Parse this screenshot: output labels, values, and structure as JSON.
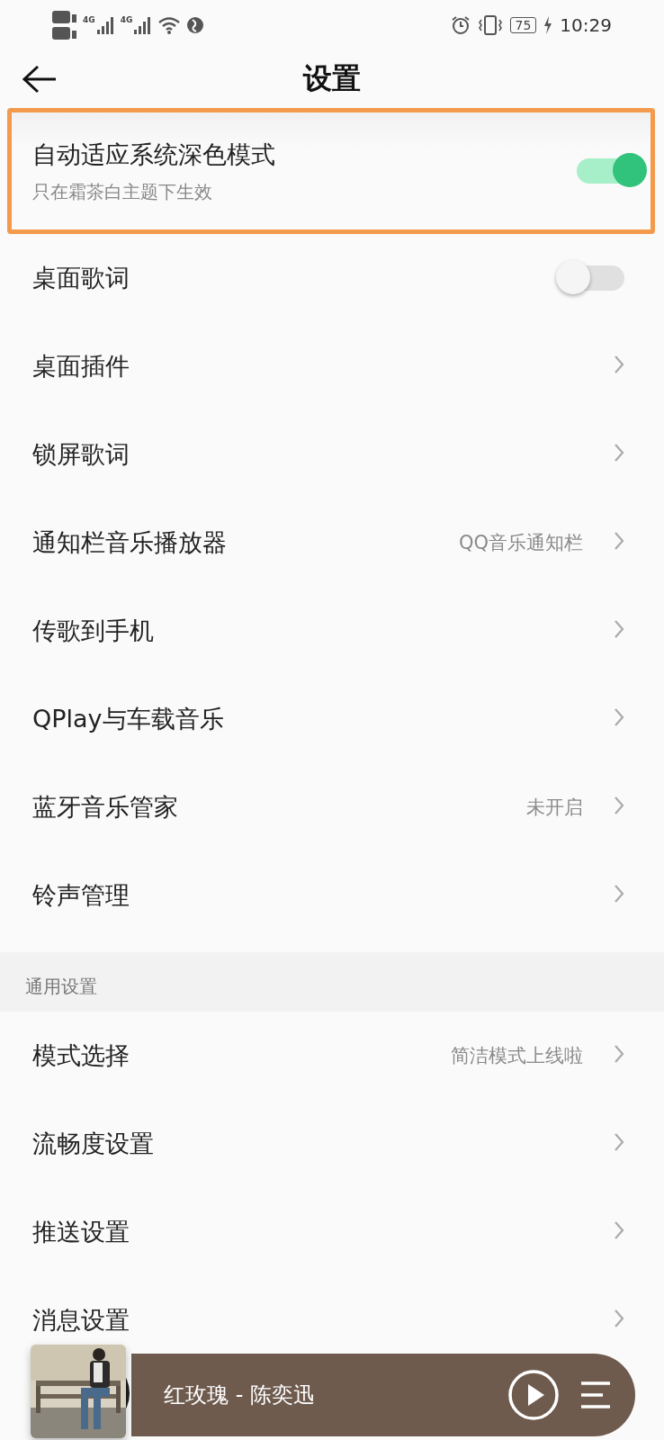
{
  "status_bar": {
    "time": "10:29",
    "battery": "75",
    "network_1": "4G",
    "network_2": "4G"
  },
  "header": {
    "title": "设置"
  },
  "rows": [
    {
      "kind": "toggle",
      "label": "自动适应系统深色模式",
      "subtitle": "只在霜茶白主题下生效",
      "on": true,
      "highlighted": true
    },
    {
      "kind": "toggle",
      "label": "桌面歌词",
      "on": false,
      "highlighted": false
    },
    {
      "kind": "link",
      "label": "桌面插件"
    },
    {
      "kind": "link",
      "label": "锁屏歌词"
    },
    {
      "kind": "link",
      "label": "通知栏音乐播放器",
      "value": "QQ音乐通知栏"
    },
    {
      "kind": "link",
      "label": "传歌到手机"
    },
    {
      "kind": "link",
      "label": "QPlay与车载音乐"
    },
    {
      "kind": "link",
      "label": "蓝牙音乐管家",
      "value": "未开启"
    },
    {
      "kind": "link",
      "label": "铃声管理"
    },
    {
      "kind": "section",
      "label": "通用设置"
    },
    {
      "kind": "link",
      "label": "模式选择",
      "value": "简洁模式上线啦"
    },
    {
      "kind": "link",
      "label": "流畅度设置"
    },
    {
      "kind": "link",
      "label": "推送设置"
    },
    {
      "kind": "link",
      "label": "消息设置"
    }
  ],
  "player": {
    "track": "红玫瑰 - 陈奕迅"
  }
}
